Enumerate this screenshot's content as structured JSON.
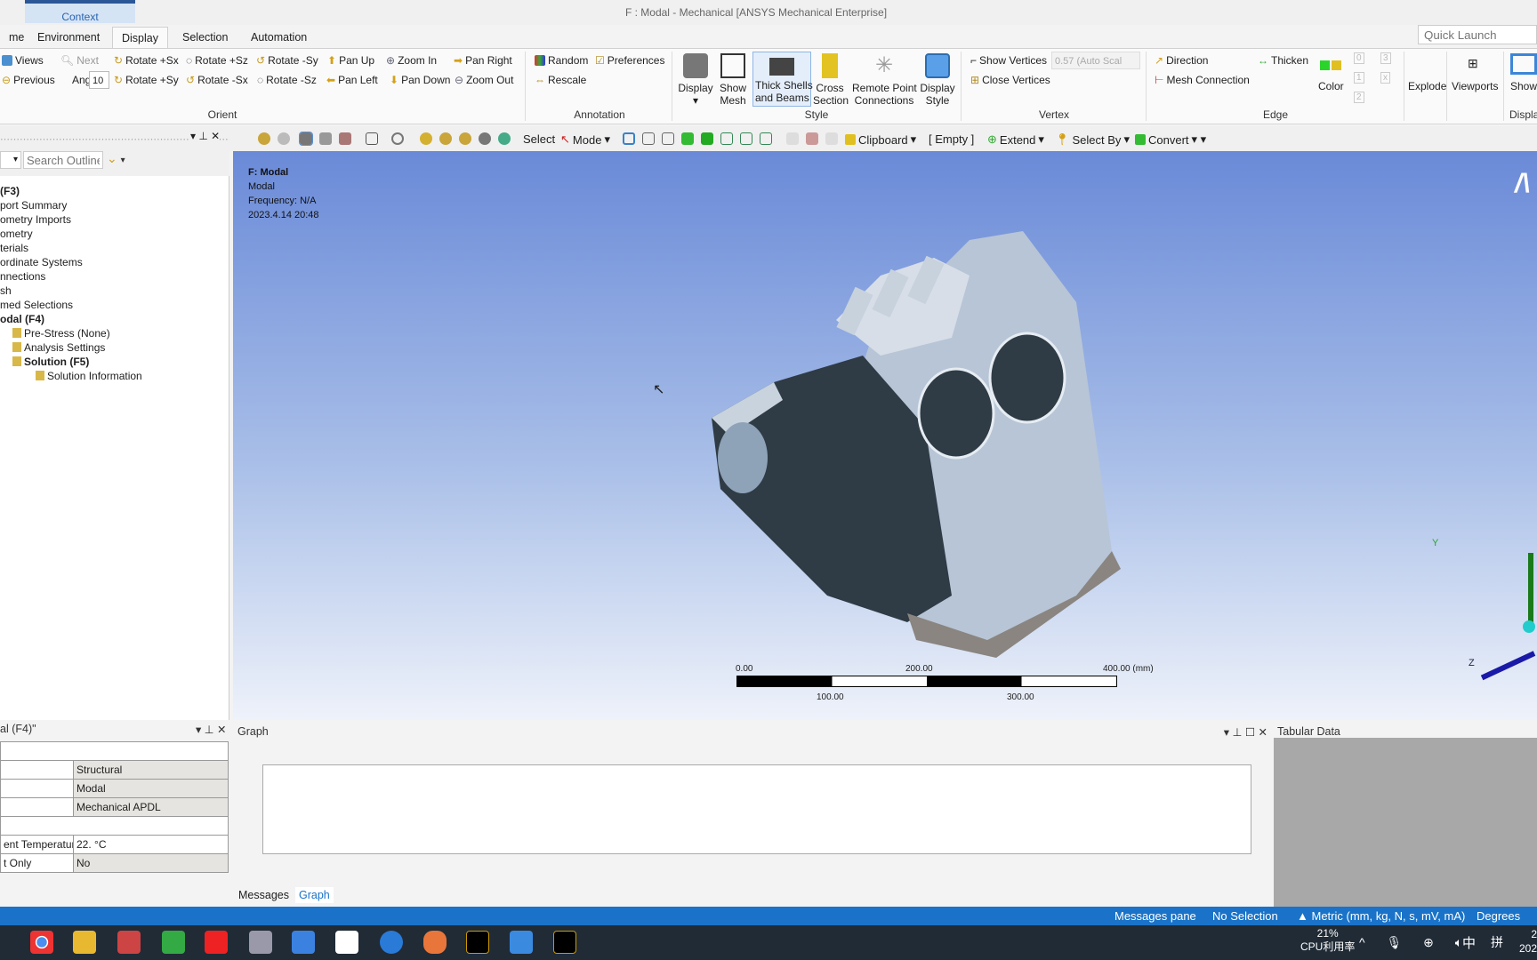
{
  "window": {
    "title": "F : Modal - Mechanical [ANSYS Mechanical Enterprise]",
    "context_tab": "Context",
    "quick_launch_placeholder": "Quick Launch"
  },
  "tabs": [
    "me",
    "Environment",
    "Display",
    "Selection",
    "Automation"
  ],
  "active_tab": "Display",
  "ribbon": {
    "orient": {
      "label": "Orient",
      "row1": [
        "Views",
        "Next",
        "Rotate +Sx",
        "Rotate +Sz",
        "Rotate -Sy",
        "Pan Up",
        "Zoom In",
        "Pan Right"
      ],
      "row2": [
        "Previous",
        "Rotate +Sy",
        "Rotate -Sx",
        "Rotate -Sz",
        "Pan Left",
        "Pan Down",
        "Zoom Out"
      ],
      "angle_label": "Angle",
      "angle_value": "10"
    },
    "annotation": {
      "label": "Annotation",
      "items": [
        "Random",
        "Preferences",
        "Rescale"
      ]
    },
    "style": {
      "label": "Style",
      "display": "Display",
      "show_mesh": [
        "Show",
        "Mesh"
      ],
      "thick": [
        "Thick Shells",
        "and Beams"
      ],
      "cross": [
        "Cross",
        "Section"
      ],
      "remote": [
        "Remote Point",
        "Connections"
      ],
      "dstyle": [
        "Display",
        "Style"
      ]
    },
    "vertex": {
      "label": "Vertex",
      "show_vertices": "Show Vertices",
      "scale_value": "0.57 (Auto Scal",
      "close_vertices": "Close Vertices"
    },
    "edge": {
      "label": "Edge",
      "direction": "Direction",
      "mesh_connection": "Mesh Connection",
      "thicken": "Thicken",
      "color": "Color",
      "dd": [
        "0",
        "3",
        "1",
        "x",
        "2"
      ]
    },
    "explode": "Explode",
    "viewports": "Viewports",
    "show": "Show",
    "display_group": "Displa"
  },
  "toolbar": {
    "select": "Select",
    "mode": "Mode",
    "clipboard": "Clipboard",
    "empty": "[ Empty ]",
    "extend": "Extend",
    "select_by": "Select By",
    "convert": "Convert"
  },
  "outline": {
    "search_placeholder": "Search Outline",
    "items": [
      {
        "label": "(F3)",
        "bold": true,
        "indent": 0
      },
      {
        "label": "port Summary",
        "indent": 0
      },
      {
        "label": "ometry Imports",
        "indent": 0
      },
      {
        "label": "ometry",
        "indent": 0
      },
      {
        "label": "terials",
        "indent": 0
      },
      {
        "label": "ordinate Systems",
        "indent": 0
      },
      {
        "label": "nnections",
        "indent": 0
      },
      {
        "label": "sh",
        "indent": 0
      },
      {
        "label": "med Selections",
        "indent": 0
      },
      {
        "label": "odal (F4)",
        "bold": true,
        "indent": 0
      },
      {
        "label": "Pre-Stress (None)",
        "indent": 1
      },
      {
        "label": "Analysis Settings",
        "indent": 1
      },
      {
        "label": "Solution (F5)",
        "bold": true,
        "indent": 1
      },
      {
        "label": "Solution Information",
        "indent": 2
      }
    ]
  },
  "viewport": {
    "info": {
      "title": "F: Modal",
      "type": "Modal",
      "frequency": "Frequency: N/A",
      "date": "2023.4.14 20:48"
    },
    "scale": {
      "top": [
        "0.00",
        "200.00",
        "400.00 (mm)"
      ],
      "bottom": [
        "100.00",
        "300.00"
      ]
    },
    "axes": {
      "y": "Y",
      "z": "Z"
    }
  },
  "details": {
    "title": "al (F4)\"",
    "rows": [
      [
        "",
        ""
      ],
      [
        "",
        "Structural"
      ],
      [
        "",
        "Modal"
      ],
      [
        "",
        "Mechanical APDL"
      ],
      [
        "",
        ""
      ],
      [
        "ent Temperature",
        "22. °C"
      ],
      [
        "t Only",
        "No"
      ]
    ]
  },
  "graph": {
    "title": "Graph",
    "tabs": [
      "Messages",
      "Graph"
    ],
    "active": "Graph"
  },
  "tabular": {
    "title": "Tabular Data"
  },
  "status": {
    "messages": "Messages pane",
    "selection": "No Selection",
    "units": "Metric (mm, kg, N, s, mV, mA)",
    "angle": "Degrees"
  },
  "taskbar": {
    "cpu_pct": "21%",
    "cpu_label": "CPU利用率",
    "ime1": "中",
    "ime2": "拼",
    "clock": "2",
    "date": "202"
  },
  "colors": {
    "accent": "#1a73c8",
    "viewport_top": "#6a8ad8",
    "viewport_bottom": "#eef2fa",
    "part_dark": "#2f3b45",
    "part_light": "#b9c7d8"
  }
}
